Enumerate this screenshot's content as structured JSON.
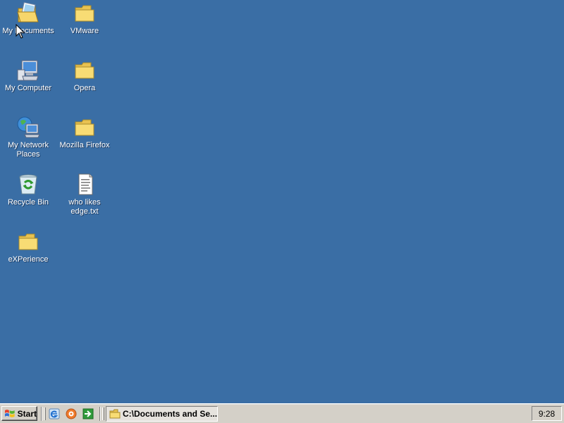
{
  "desktop": {
    "background_color": "#3a6ea5",
    "icons": [
      {
        "label": "My Documents",
        "icon": "my-documents-icon"
      },
      {
        "label": "VMware",
        "icon": "folder-icon"
      },
      {
        "label": "My Computer",
        "icon": "my-computer-icon"
      },
      {
        "label": "Opera",
        "icon": "folder-icon"
      },
      {
        "label": "My Network Places",
        "icon": "network-places-icon"
      },
      {
        "label": "Mozilla Firefox",
        "icon": "folder-icon"
      },
      {
        "label": "Recycle Bin",
        "icon": "recycle-bin-icon"
      },
      {
        "label": "who likes edge.txt",
        "icon": "text-file-icon"
      },
      {
        "label": "eXPerience",
        "icon": "folder-icon"
      }
    ]
  },
  "taskbar": {
    "start_label": "Start",
    "quick_launch": [
      {
        "name": "internet-explorer-icon"
      },
      {
        "name": "media-player-icon"
      },
      {
        "name": "show-desktop-icon"
      }
    ],
    "task": {
      "label": "C:\\Documents and Se..."
    },
    "clock": "9:28"
  }
}
